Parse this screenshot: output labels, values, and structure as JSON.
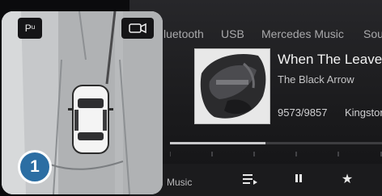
{
  "camera": {
    "park_label": "Pᵘ",
    "marker_number": "1"
  },
  "media": {
    "tabs": [
      "luetooth",
      "USB",
      "Mercedes Music",
      "Sou"
    ],
    "track": {
      "title": "When The Leaves Fa",
      "artist": "The Black Arrow",
      "number": "9573/9857",
      "location": "Kingston"
    },
    "progress_fraction": 0.45,
    "bottom_label": "Music"
  },
  "colors": {
    "marker_blue": "#2c6ea3",
    "background": "#0b0b0d"
  }
}
